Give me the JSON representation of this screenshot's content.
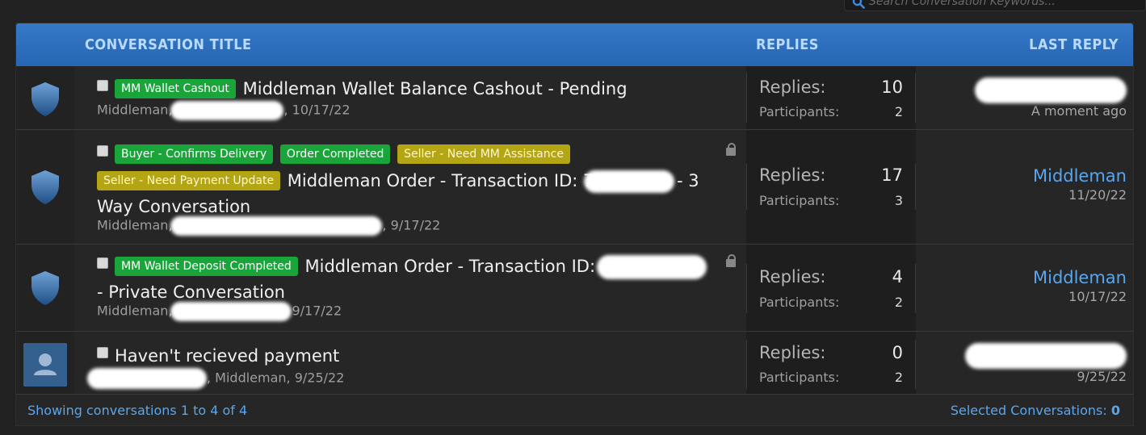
{
  "search": {
    "placeholder": "Search Conversation Keywords..."
  },
  "header": {
    "title": "CONVERSATION TITLE",
    "replies": "REPLIES",
    "last_reply": "LAST REPLY"
  },
  "stat_labels": {
    "replies": "Replies:",
    "participants": "Participants:"
  },
  "rows": [
    {
      "tags": [
        "MM Wallet Cashout"
      ],
      "title": "Middleman Wallet Balance Cashout - Pending",
      "meta_prefix": "Middleman,",
      "meta_date": ", 10/17/22",
      "replies": "10",
      "participants": "2",
      "last_name": "",
      "last_date": "A moment ago"
    },
    {
      "tags": [
        "Buyer - Confirms Delivery",
        "Order Completed",
        "Seller - Need MM Assistance",
        "Seller - Need Payment Update"
      ],
      "title_a": "Middleman Order - Transaction ID: 7",
      "title_b": "- 3",
      "title_c": "Way Conversation",
      "meta_prefix": "Middleman,",
      "meta_date": ", 9/17/22",
      "replies": "17",
      "participants": "3",
      "last_name": "Middleman",
      "last_date": "11/20/22"
    },
    {
      "tags": [
        "MM Wallet Deposit Completed"
      ],
      "title_a": "Middleman Order - Transaction ID:",
      "title_c": "- Private Conversation",
      "meta_prefix": "Middleman,",
      "meta_date": "9/17/22",
      "replies": "4",
      "participants": "2",
      "last_name": "Middleman",
      "last_date": "10/17/22"
    },
    {
      "title": "Haven't recieved payment",
      "meta_mid": ", Middleman, 9/25/22",
      "replies": "0",
      "participants": "2",
      "last_date": "9/25/22"
    }
  ],
  "footer": {
    "showing": "Showing conversations 1 to 4 of 4",
    "selected_label": "Selected Conversations:",
    "selected_count": "0"
  },
  "colors": {
    "header": "#2e6fbf",
    "link": "#5aa6ee",
    "tag_green": "#19a53a",
    "tag_olive": "#b4a514"
  }
}
